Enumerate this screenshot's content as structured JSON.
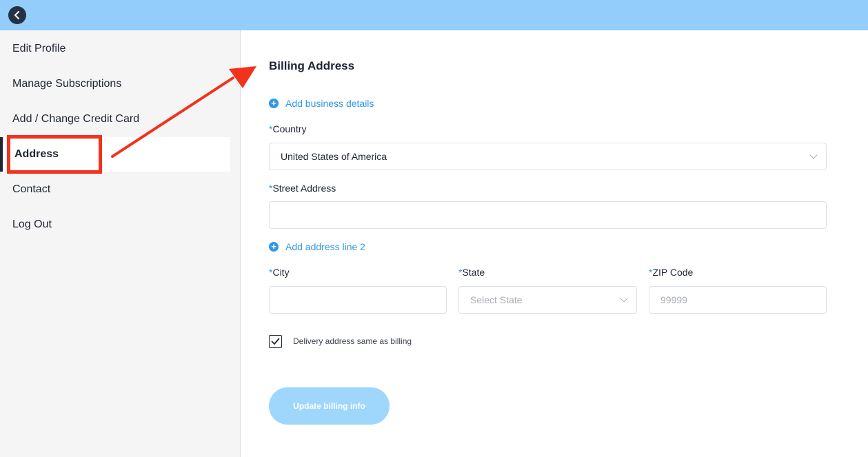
{
  "sidebar": {
    "items": [
      {
        "label": "Edit Profile"
      },
      {
        "label": "Manage Subscriptions"
      },
      {
        "label": "Add / Change Credit Card"
      },
      {
        "label": "Address"
      },
      {
        "label": "Contact"
      },
      {
        "label": "Log Out"
      }
    ],
    "active_index": 3
  },
  "main": {
    "title": "Billing Address",
    "add_business_label": "Add business details",
    "country": {
      "required_mark": "*",
      "label": "Country",
      "value": "United States of America"
    },
    "street": {
      "required_mark": "*",
      "label": "Street Address",
      "value": ""
    },
    "add_line2_label": "Add address line 2",
    "city": {
      "required_mark": "*",
      "label": "City",
      "value": ""
    },
    "state": {
      "required_mark": "*",
      "label": "State",
      "placeholder": "Select State"
    },
    "zip": {
      "required_mark": "*",
      "label": "ZIP Code",
      "placeholder": "99999"
    },
    "delivery_checkbox": {
      "label": "Delivery address same as billing",
      "checked": true
    },
    "update_button_label": "Update billing info"
  },
  "colors": {
    "topbar": "#92cdfb",
    "accent": "#2e97e8",
    "annotation": "#f2321c",
    "button_disabled": "#9fd6fb"
  },
  "icons": [
    "back-arrow-icon",
    "plus-circle-icon",
    "chevron-down-icon",
    "checkmark-icon"
  ]
}
